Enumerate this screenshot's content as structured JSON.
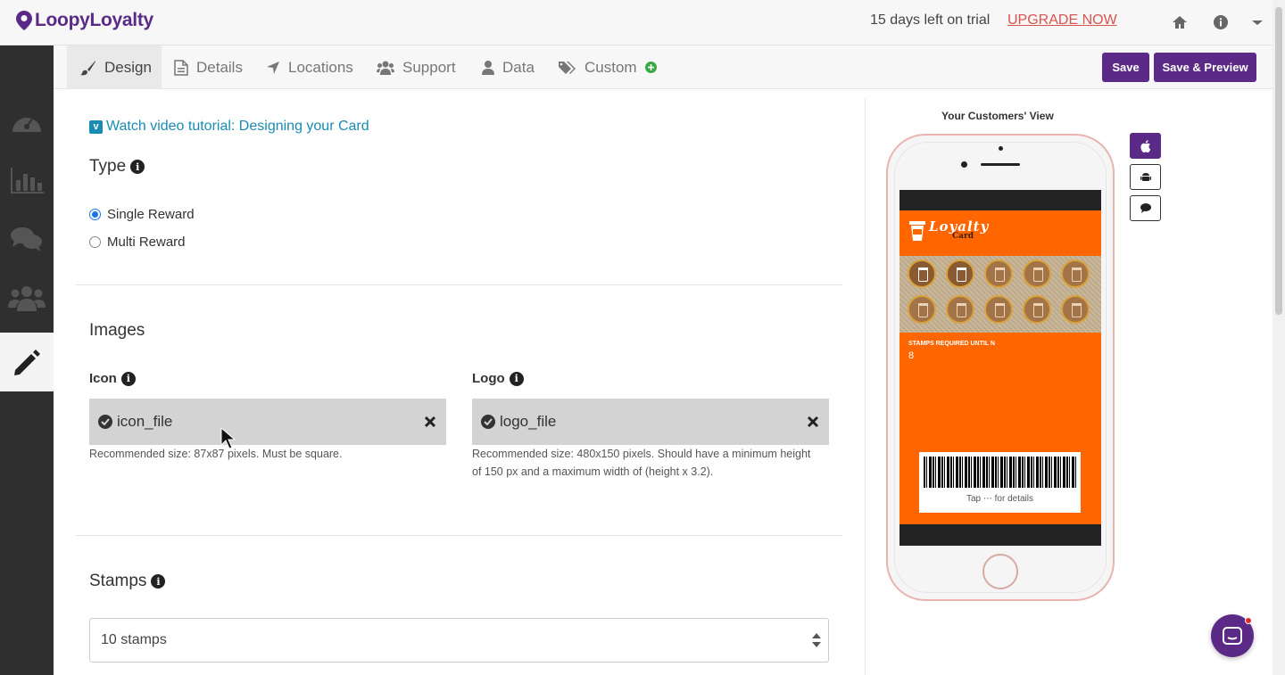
{
  "brand": {
    "name": "LoopyLoyalty"
  },
  "header": {
    "trial_text": "15 days left on trial",
    "upgrade_label": "UPGRADE NOW"
  },
  "tabs": [
    {
      "label": "Design",
      "icon": "brush-icon",
      "active": true
    },
    {
      "label": "Details",
      "icon": "document-icon"
    },
    {
      "label": "Locations",
      "icon": "location-arrow-icon"
    },
    {
      "label": "Support",
      "icon": "users-icon"
    },
    {
      "label": "Data",
      "icon": "user-icon"
    },
    {
      "label": "Custom",
      "icon": "tags-icon"
    }
  ],
  "toolbar": {
    "save_label": "Save",
    "save_preview_label": "Save & Preview"
  },
  "sidebar": {
    "items": [
      "dashboard-icon",
      "bar-chart-icon",
      "chat-icon",
      "group-icon",
      "pencil-icon"
    ]
  },
  "design": {
    "video_link": "Watch video tutorial: Designing your Card",
    "type_title": "Type",
    "types": [
      {
        "label": "Single Reward",
        "selected": true
      },
      {
        "label": "Multi Reward",
        "selected": false
      }
    ],
    "images_title": "Images",
    "icon_label": "Icon",
    "icon_file": "icon_file",
    "icon_help": "Recommended size: 87x87 pixels. Must be square.",
    "logo_label": "Logo",
    "logo_file": "logo_file",
    "logo_help_line1": "Recommended size: 480x150 pixels. Should have a minimum height",
    "logo_help_line2": "of 150 px and a maximum width of (height x 3.2).",
    "stamps_title": "Stamps",
    "stamps_value": "10 stamps"
  },
  "preview": {
    "title": "Your Customers' View",
    "card_logo_line1": "Loyalty",
    "card_logo_line2": "Card",
    "stamps_total": 10,
    "stamps_filled": 2,
    "stamps_label": "STAMPS REQUIRED UNTIL N",
    "stamps_value": "8",
    "tap_text": "Tap ⋯ for details"
  },
  "colors": {
    "brand": "#5b2a86",
    "card": "#ff6600",
    "upgrade": "#d9534f",
    "link": "#1a8bb3"
  }
}
